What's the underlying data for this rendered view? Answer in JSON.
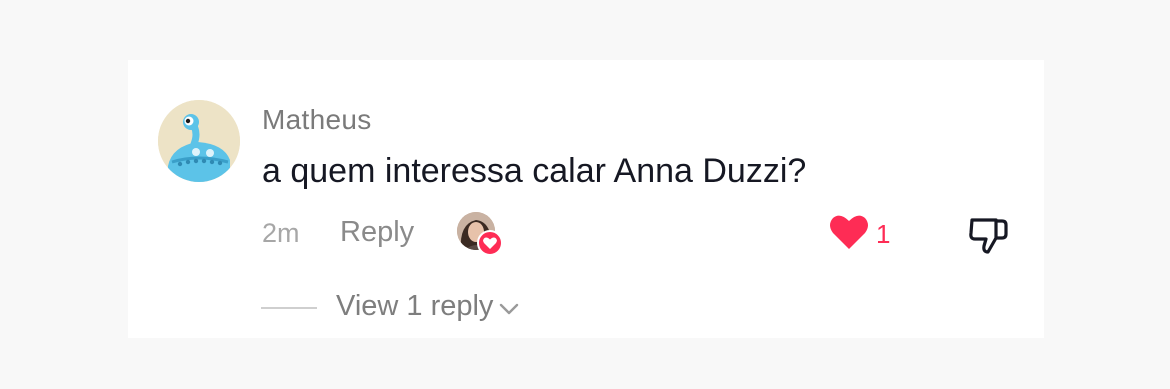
{
  "comment": {
    "username": "Matheus",
    "text": "a quem interessa calar Anna Duzzi?",
    "timestamp": "2m",
    "reply_label": "Reply",
    "like_count": "1",
    "liked": true,
    "liked_by_creator": true,
    "view_replies_label": "View 1 reply"
  },
  "icons": {
    "avatar": "cartoon-alien-avatar",
    "creator_liked": "creator-avatar-with-heart-icon",
    "like": "heart-icon",
    "dislike": "thumbs-down-icon",
    "expand": "chevron-down-icon"
  },
  "colors": {
    "like_red": "#fe2c55",
    "username_gray": "#7a7a7a",
    "text_dark": "#161823"
  }
}
